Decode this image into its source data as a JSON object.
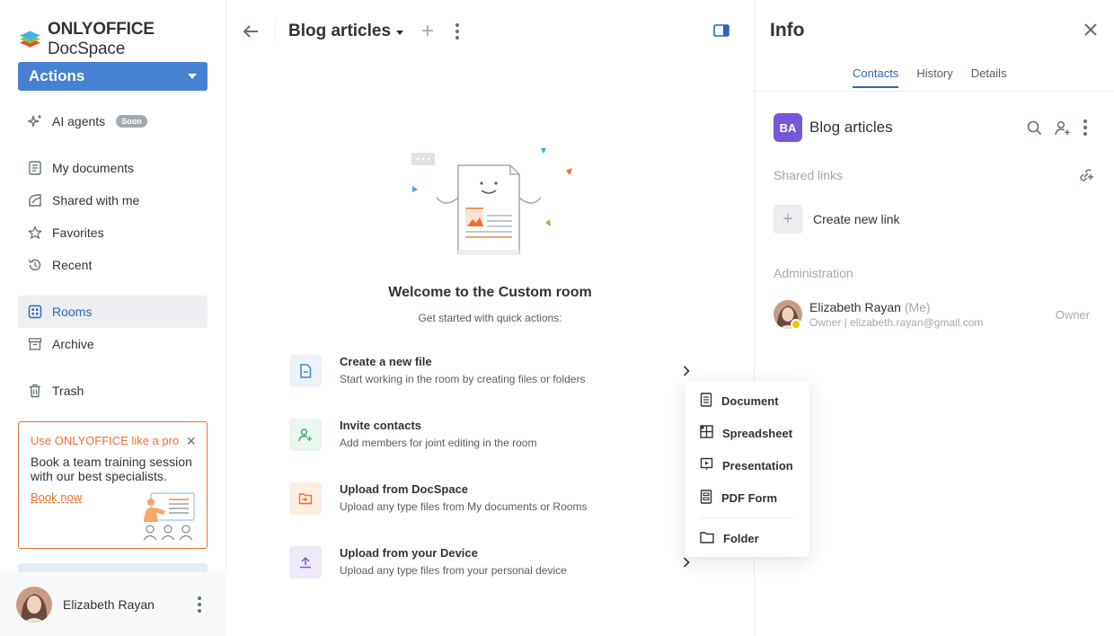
{
  "sidebar": {
    "brand": {
      "bold": "ONLYOFFICE",
      "light": " DocSpace"
    },
    "actions_label": "Actions",
    "items": {
      "ai_agents": "AI agents",
      "soon_badge": "Soon",
      "my_documents": "My documents",
      "shared_with_me": "Shared with me",
      "favorites": "Favorites",
      "recent": "Recent",
      "rooms": "Rooms",
      "archive": "Archive",
      "trash": "Trash"
    },
    "promo": {
      "title": "Use ONLYOFFICE like a pro",
      "body": "Book a team training session with our best specialists.",
      "link": "Book now"
    },
    "profile_name": "Elizabeth Rayan"
  },
  "main": {
    "room_title": "Blog articles",
    "welcome_title": "Welcome to the Custom room",
    "welcome_sub": "Get started with quick actions:",
    "quick_actions": [
      {
        "title": "Create a new file",
        "desc": "Start working in the room by creating files or folders"
      },
      {
        "title": "Invite contacts",
        "desc": "Add members for joint editing in the room"
      },
      {
        "title": "Upload from DocSpace",
        "desc": "Upload any type files from My documents or Rooms"
      },
      {
        "title": "Upload from your Device",
        "desc": "Upload any type files from your personal device"
      }
    ]
  },
  "dropdown": {
    "items": [
      "Document",
      "Spreadsheet",
      "Presentation",
      "PDF Form",
      "Folder"
    ]
  },
  "info": {
    "title": "Info",
    "tabs": [
      "Contacts",
      "History",
      "Details"
    ],
    "active_tab": "Contacts",
    "room_badge": "BA",
    "room_name": "Blog articles",
    "shared_links_label": "Shared links",
    "create_link_label": "Create new link",
    "administration_label": "Administration",
    "member": {
      "name": "Elizabeth Rayan",
      "me": "(Me)",
      "meta": "Owner | elizabeth.rayan@gmail.com",
      "role": "Owner"
    }
  },
  "colors": {
    "accent": "#4781d1",
    "link_blue": "#2c66b8",
    "promo_orange": "#f26e2b",
    "room_badge": "#7757d9",
    "owner_badge": "#edc409"
  }
}
